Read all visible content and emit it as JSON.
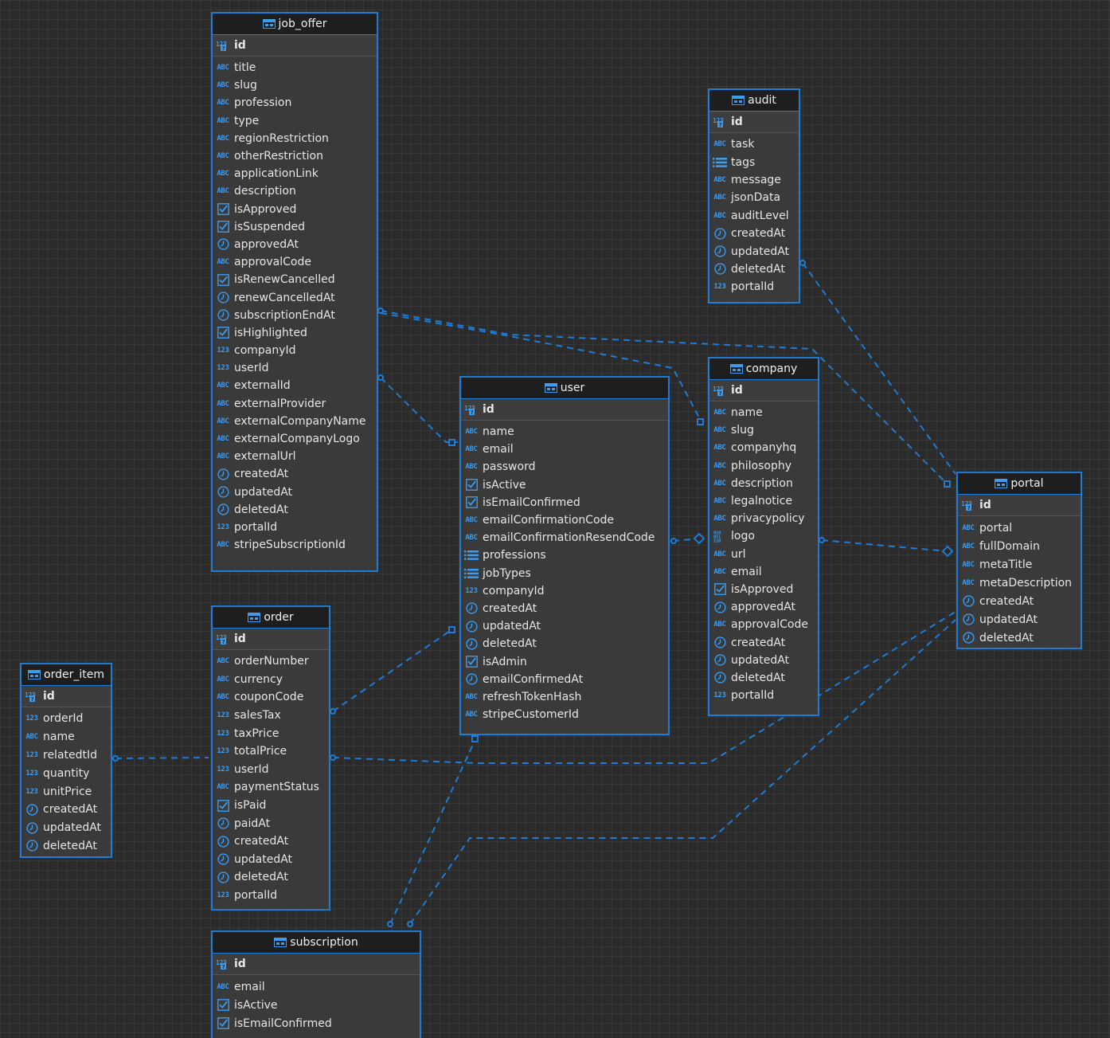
{
  "colors": {
    "background": "#2b2b2b",
    "accent": "#1f7bd4",
    "header": "#1e1e1e",
    "entity_bg": "#3a3a3a"
  },
  "entities": [
    {
      "name": "job_offer",
      "pk": {
        "name": "id",
        "type": "num"
      },
      "columns": [
        {
          "name": "title",
          "type": "text"
        },
        {
          "name": "slug",
          "type": "text"
        },
        {
          "name": "profession",
          "type": "text"
        },
        {
          "name": "type",
          "type": "text"
        },
        {
          "name": "regionRestriction",
          "type": "text"
        },
        {
          "name": "otherRestriction",
          "type": "text"
        },
        {
          "name": "applicationLink",
          "type": "text"
        },
        {
          "name": "description",
          "type": "text"
        },
        {
          "name": "isApproved",
          "type": "bool"
        },
        {
          "name": "isSuspended",
          "type": "bool"
        },
        {
          "name": "approvedAt",
          "type": "date"
        },
        {
          "name": "approvalCode",
          "type": "text"
        },
        {
          "name": "isRenewCancelled",
          "type": "bool"
        },
        {
          "name": "renewCancelledAt",
          "type": "date"
        },
        {
          "name": "subscriptionEndAt",
          "type": "date"
        },
        {
          "name": "isHighlighted",
          "type": "bool"
        },
        {
          "name": "companyId",
          "type": "num"
        },
        {
          "name": "userId",
          "type": "num"
        },
        {
          "name": "externalId",
          "type": "text"
        },
        {
          "name": "externalProvider",
          "type": "text"
        },
        {
          "name": "externalCompanyName",
          "type": "text"
        },
        {
          "name": "externalCompanyLogo",
          "type": "text"
        },
        {
          "name": "externalUrl",
          "type": "text"
        },
        {
          "name": "createdAt",
          "type": "date"
        },
        {
          "name": "updatedAt",
          "type": "date"
        },
        {
          "name": "deletedAt",
          "type": "date"
        },
        {
          "name": "portalId",
          "type": "num"
        },
        {
          "name": "stripeSubscriptionId",
          "type": "text"
        }
      ]
    },
    {
      "name": "audit",
      "pk": {
        "name": "id",
        "type": "num"
      },
      "columns": [
        {
          "name": "task",
          "type": "text"
        },
        {
          "name": "tags",
          "type": "array"
        },
        {
          "name": "message",
          "type": "text"
        },
        {
          "name": "jsonData",
          "type": "text"
        },
        {
          "name": "auditLevel",
          "type": "text"
        },
        {
          "name": "createdAt",
          "type": "date"
        },
        {
          "name": "updatedAt",
          "type": "date"
        },
        {
          "name": "deletedAt",
          "type": "date"
        },
        {
          "name": "portalId",
          "type": "num"
        }
      ]
    },
    {
      "name": "user",
      "pk": {
        "name": "id",
        "type": "num"
      },
      "columns": [
        {
          "name": "name",
          "type": "text"
        },
        {
          "name": "email",
          "type": "text"
        },
        {
          "name": "password",
          "type": "text"
        },
        {
          "name": "isActive",
          "type": "bool"
        },
        {
          "name": "isEmailConfirmed",
          "type": "bool"
        },
        {
          "name": "emailConfirmationCode",
          "type": "text"
        },
        {
          "name": "emailConfirmationResendCode",
          "type": "text"
        },
        {
          "name": "professions",
          "type": "array"
        },
        {
          "name": "jobTypes",
          "type": "array"
        },
        {
          "name": "companyId",
          "type": "num"
        },
        {
          "name": "createdAt",
          "type": "date"
        },
        {
          "name": "updatedAt",
          "type": "date"
        },
        {
          "name": "deletedAt",
          "type": "date"
        },
        {
          "name": "isAdmin",
          "type": "bool"
        },
        {
          "name": "emailConfirmedAt",
          "type": "date"
        },
        {
          "name": "refreshTokenHash",
          "type": "text"
        },
        {
          "name": "stripeCustomerId",
          "type": "text"
        }
      ]
    },
    {
      "name": "company",
      "pk": {
        "name": "id",
        "type": "num"
      },
      "columns": [
        {
          "name": "name",
          "type": "text"
        },
        {
          "name": "slug",
          "type": "text"
        },
        {
          "name": "companyhq",
          "type": "text"
        },
        {
          "name": "philosophy",
          "type": "text"
        },
        {
          "name": "description",
          "type": "text"
        },
        {
          "name": "legalnotice",
          "type": "text"
        },
        {
          "name": "privacypolicy",
          "type": "text"
        },
        {
          "name": "logo",
          "type": "binary"
        },
        {
          "name": "url",
          "type": "text"
        },
        {
          "name": "email",
          "type": "text"
        },
        {
          "name": "isApproved",
          "type": "bool"
        },
        {
          "name": "approvedAt",
          "type": "date"
        },
        {
          "name": "approvalCode",
          "type": "text"
        },
        {
          "name": "createdAt",
          "type": "date"
        },
        {
          "name": "updatedAt",
          "type": "date"
        },
        {
          "name": "deletedAt",
          "type": "date"
        },
        {
          "name": "portalId",
          "type": "num"
        }
      ]
    },
    {
      "name": "portal",
      "pk": {
        "name": "id",
        "type": "num"
      },
      "columns": [
        {
          "name": "portal",
          "type": "text"
        },
        {
          "name": "fullDomain",
          "type": "text"
        },
        {
          "name": "metaTitle",
          "type": "text"
        },
        {
          "name": "metaDescription",
          "type": "text"
        },
        {
          "name": "createdAt",
          "type": "date"
        },
        {
          "name": "updatedAt",
          "type": "date"
        },
        {
          "name": "deletedAt",
          "type": "date"
        }
      ]
    },
    {
      "name": "order",
      "pk": {
        "name": "id",
        "type": "num"
      },
      "columns": [
        {
          "name": "orderNumber",
          "type": "text"
        },
        {
          "name": "currency",
          "type": "text"
        },
        {
          "name": "couponCode",
          "type": "text"
        },
        {
          "name": "salesTax",
          "type": "num"
        },
        {
          "name": "taxPrice",
          "type": "num"
        },
        {
          "name": "totalPrice",
          "type": "num"
        },
        {
          "name": "userId",
          "type": "num"
        },
        {
          "name": "paymentStatus",
          "type": "text"
        },
        {
          "name": "isPaid",
          "type": "bool"
        },
        {
          "name": "paidAt",
          "type": "date"
        },
        {
          "name": "createdAt",
          "type": "date"
        },
        {
          "name": "updatedAt",
          "type": "date"
        },
        {
          "name": "deletedAt",
          "type": "date"
        },
        {
          "name": "portalId",
          "type": "num"
        }
      ]
    },
    {
      "name": "order_item",
      "pk": {
        "name": "id",
        "type": "num"
      },
      "columns": [
        {
          "name": "orderId",
          "type": "num"
        },
        {
          "name": "name",
          "type": "text"
        },
        {
          "name": "relatedtId",
          "type": "num"
        },
        {
          "name": "quantity",
          "type": "num"
        },
        {
          "name": "unitPrice",
          "type": "num"
        },
        {
          "name": "createdAt",
          "type": "date"
        },
        {
          "name": "updatedAt",
          "type": "date"
        },
        {
          "name": "deletedAt",
          "type": "date"
        }
      ]
    },
    {
      "name": "subscription",
      "pk": {
        "name": "id",
        "type": "num"
      },
      "columns": [
        {
          "name": "email",
          "type": "text"
        },
        {
          "name": "isActive",
          "type": "bool"
        },
        {
          "name": "isEmailConfirmed",
          "type": "bool"
        }
      ]
    }
  ]
}
